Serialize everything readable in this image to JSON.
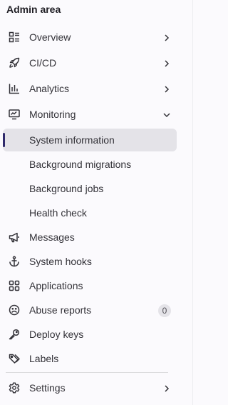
{
  "sidebar": {
    "title": "Admin area",
    "items": [
      {
        "label": "Overview",
        "icon": "overview-icon",
        "expandable": true
      },
      {
        "label": "CI/CD",
        "icon": "rocket-icon",
        "expandable": true
      },
      {
        "label": "Analytics",
        "icon": "chart-icon",
        "expandable": true
      },
      {
        "label": "Monitoring",
        "icon": "monitor-icon",
        "expandable": true,
        "expanded": true
      },
      {
        "label": "System information",
        "active": true
      },
      {
        "label": "Background migrations"
      },
      {
        "label": "Background jobs"
      },
      {
        "label": "Health check"
      },
      {
        "label": "Messages",
        "icon": "bullhorn-icon"
      },
      {
        "label": "System hooks",
        "icon": "anchor-icon"
      },
      {
        "label": "Applications",
        "icon": "applications-icon"
      },
      {
        "label": "Abuse reports",
        "icon": "abuse-icon",
        "badge": "0"
      },
      {
        "label": "Deploy keys",
        "icon": "key-icon"
      },
      {
        "label": "Labels",
        "icon": "labels-icon"
      },
      {
        "label": "Settings",
        "icon": "settings-icon",
        "expandable": true
      }
    ]
  },
  "colors": {
    "background": "#fbfafd",
    "active_background": "#e4e3e8",
    "active_indicator": "#2f2a6b",
    "text": "#333238"
  }
}
